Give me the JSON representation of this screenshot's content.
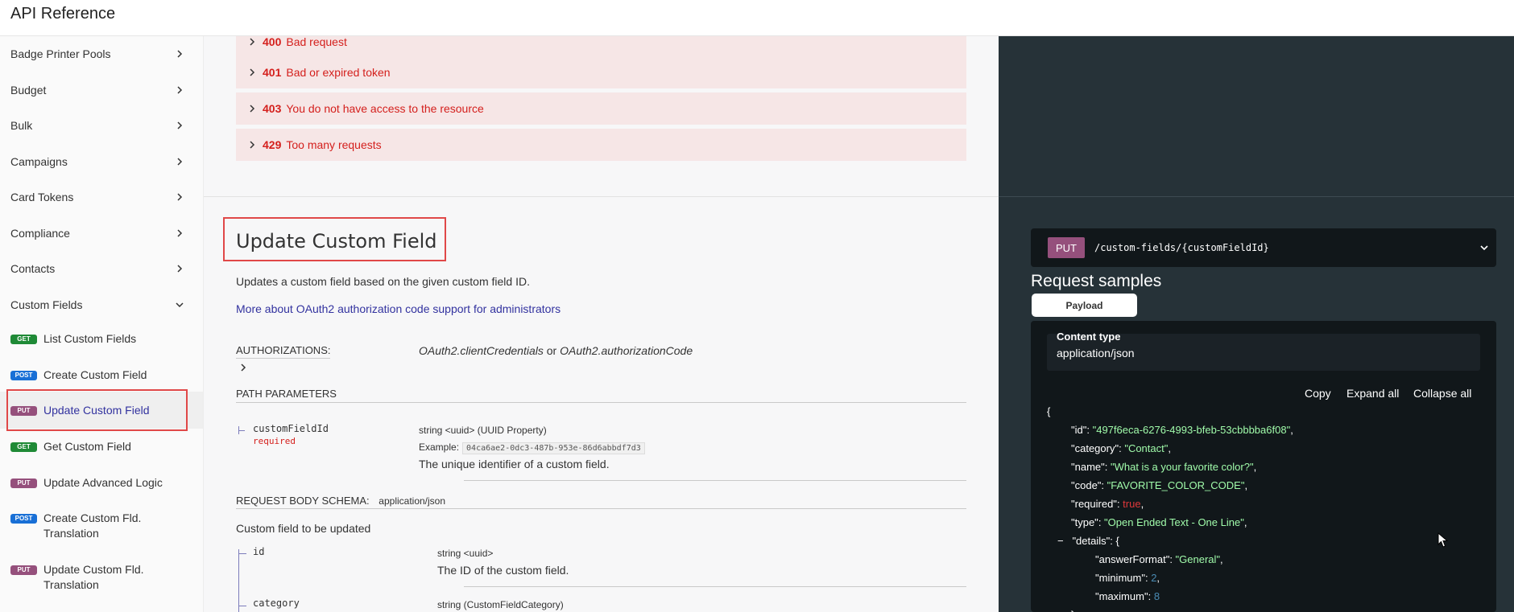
{
  "app": {
    "title": "API Reference"
  },
  "sidebar": {
    "groups": [
      {
        "label": "Badge Printer Pools"
      },
      {
        "label": "Budget"
      },
      {
        "label": "Bulk"
      },
      {
        "label": "Campaigns"
      },
      {
        "label": "Card Tokens"
      },
      {
        "label": "Compliance"
      },
      {
        "label": "Contacts"
      },
      {
        "label": "Custom Fields"
      }
    ],
    "items": [
      {
        "method": "GET",
        "label": "List Custom Fields",
        "color": "#1f8a36"
      },
      {
        "method": "POST",
        "label": "Create Custom Field",
        "color": "#186fd6"
      },
      {
        "method": "PUT",
        "label": "Update Custom Field",
        "color": "#95507c"
      },
      {
        "method": "GET",
        "label": "Get Custom Field",
        "color": "#1f8a36"
      },
      {
        "method": "PUT",
        "label": "Update Advanced Logic",
        "color": "#95507c"
      },
      {
        "method": "POST",
        "label": "Create Custom Fld. Translation",
        "color": "#186fd6"
      },
      {
        "method": "PUT",
        "label": "Update Custom Fld. Translation",
        "color": "#95507c"
      }
    ]
  },
  "responses": [
    {
      "code": "400",
      "text": "Bad request"
    },
    {
      "code": "401",
      "text": "Bad or expired token"
    },
    {
      "code": "403",
      "text": "You do not have access to the resource"
    },
    {
      "code": "429",
      "text": "Too many requests"
    }
  ],
  "operation": {
    "title": "Update Custom Field",
    "description": "Updates a custom field based on the given custom field ID.",
    "oauth_link": "More about OAuth2 authorization code support for administrators",
    "auth_label": "AUTHORIZATIONS:",
    "auth_value_1": "OAuth2.clientCredentials",
    "auth_or": "or",
    "auth_value_2": "OAuth2.authorizationCode",
    "path_params_label": "PATH PARAMETERS",
    "path_param": {
      "name": "customFieldId",
      "required": "required",
      "type": "string <uuid> (UUID Property)",
      "example_label": "Example:",
      "example": "04ca6ae2-0dc3-487b-953e-86d6abbdf7d3",
      "desc": "The unique identifier of a custom field."
    },
    "body_label": "REQUEST BODY SCHEMA:",
    "body_type": "application/json",
    "body_desc": "Custom field to be updated",
    "body_params": [
      {
        "name": "id",
        "type": "string <uuid>",
        "desc": "The ID of the custom field."
      },
      {
        "name": "category",
        "type": "string (CustomFieldCategory)"
      }
    ]
  },
  "request": {
    "method": "PUT",
    "path": "/custom-fields/{customFieldId}",
    "samples_title": "Request samples",
    "tab": "Payload",
    "content_type_label": "Content type",
    "content_type": "application/json",
    "buttons": {
      "copy": "Copy",
      "expand": "Expand all",
      "collapse": "Collapse all"
    },
    "json": {
      "open": "{",
      "id_key": "\"id\"",
      "id_val": "\"497f6eca-6276-4993-bfeb-53cbbbba6f08\"",
      "category_key": "\"category\"",
      "category_val": "\"Contact\"",
      "name_key": "\"name\"",
      "name_val": "\"What is a your favorite color?\"",
      "code_key": "\"code\"",
      "code_val": "\"FAVORITE_COLOR_CODE\"",
      "required_key": "\"required\"",
      "required_val": "true",
      "type_key": "\"type\"",
      "type_val": "\"Open Ended Text - One Line\"",
      "collapse_toggle": "−",
      "details_key": "\"details\"",
      "details_open": "{",
      "answer_key": "\"answerFormat\"",
      "answer_val": "\"General\"",
      "min_key": "\"minimum\"",
      "min_val": "2",
      "max_key": "\"maximum\"",
      "max_val": "8",
      "details_close": "},"
    }
  }
}
